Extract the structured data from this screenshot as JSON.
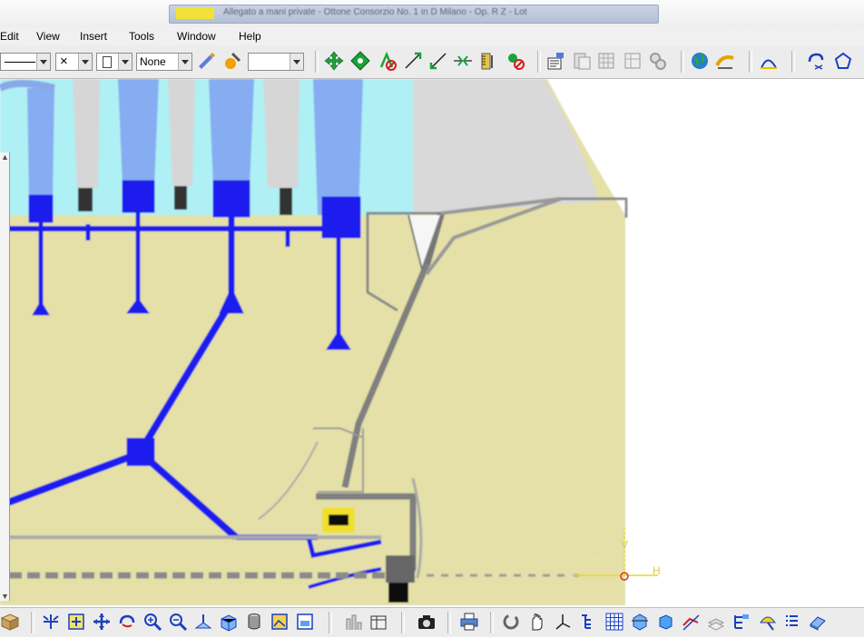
{
  "window": {
    "title": "Allegato a mani private - Ottone Consorzio No. 1 in D Milano - Op. R Z - Lot"
  },
  "menu": [
    "Edit",
    "View",
    "Insert",
    "Tools",
    "Window",
    "Help"
  ],
  "toolbar_top": {
    "linetype_combo": "",
    "point_combo": "×",
    "thickness_combo": "",
    "layer_filter_combo": "None",
    "color_combo": "",
    "icons": [
      "pan-icon",
      "fit-all-icon",
      "no-snap-icon",
      "line-icon",
      "extend-icon",
      "align-icon",
      "ruler-icon",
      "cut-icon",
      "properties-icon",
      "layer-icon",
      "table-icon",
      "grid-icon",
      "gears-icon",
      "globe-icon",
      "render-icon",
      "curve-icon",
      "axis-transform-icon",
      "polygon-icon"
    ]
  },
  "toolbar_bottom": {
    "icons": [
      "cube-icon",
      "zoom-fit-icon",
      "fit-window-icon",
      "move-icon",
      "rotate-icon",
      "zoom-in-icon",
      "zoom-out-icon",
      "normal-view-icon",
      "iso-view-icon",
      "cylinder-icon",
      "image-icon",
      "frame-icon",
      "chart-icon",
      "table-insert-icon",
      "camera-icon",
      "print-icon",
      "refresh-icon",
      "hand-icon",
      "axes-icon",
      "tree-icon",
      "mesh-icon",
      "cube-view-icon",
      "box-icon",
      "wire-icon",
      "layers-icon",
      "structure-icon",
      "lamp-icon",
      "list-icon",
      "eraser-icon"
    ]
  },
  "axis_labels": {
    "v": "V",
    "h": "H"
  },
  "colors": {
    "land": "#e4e0a8",
    "water": "#aef0f4",
    "building_blue": "#86adf2",
    "network_blue": "#1a1aee",
    "road_grey": "#8a8a8a",
    "axis_yellow": "#e8d72a",
    "axis_red": "#d83232"
  }
}
